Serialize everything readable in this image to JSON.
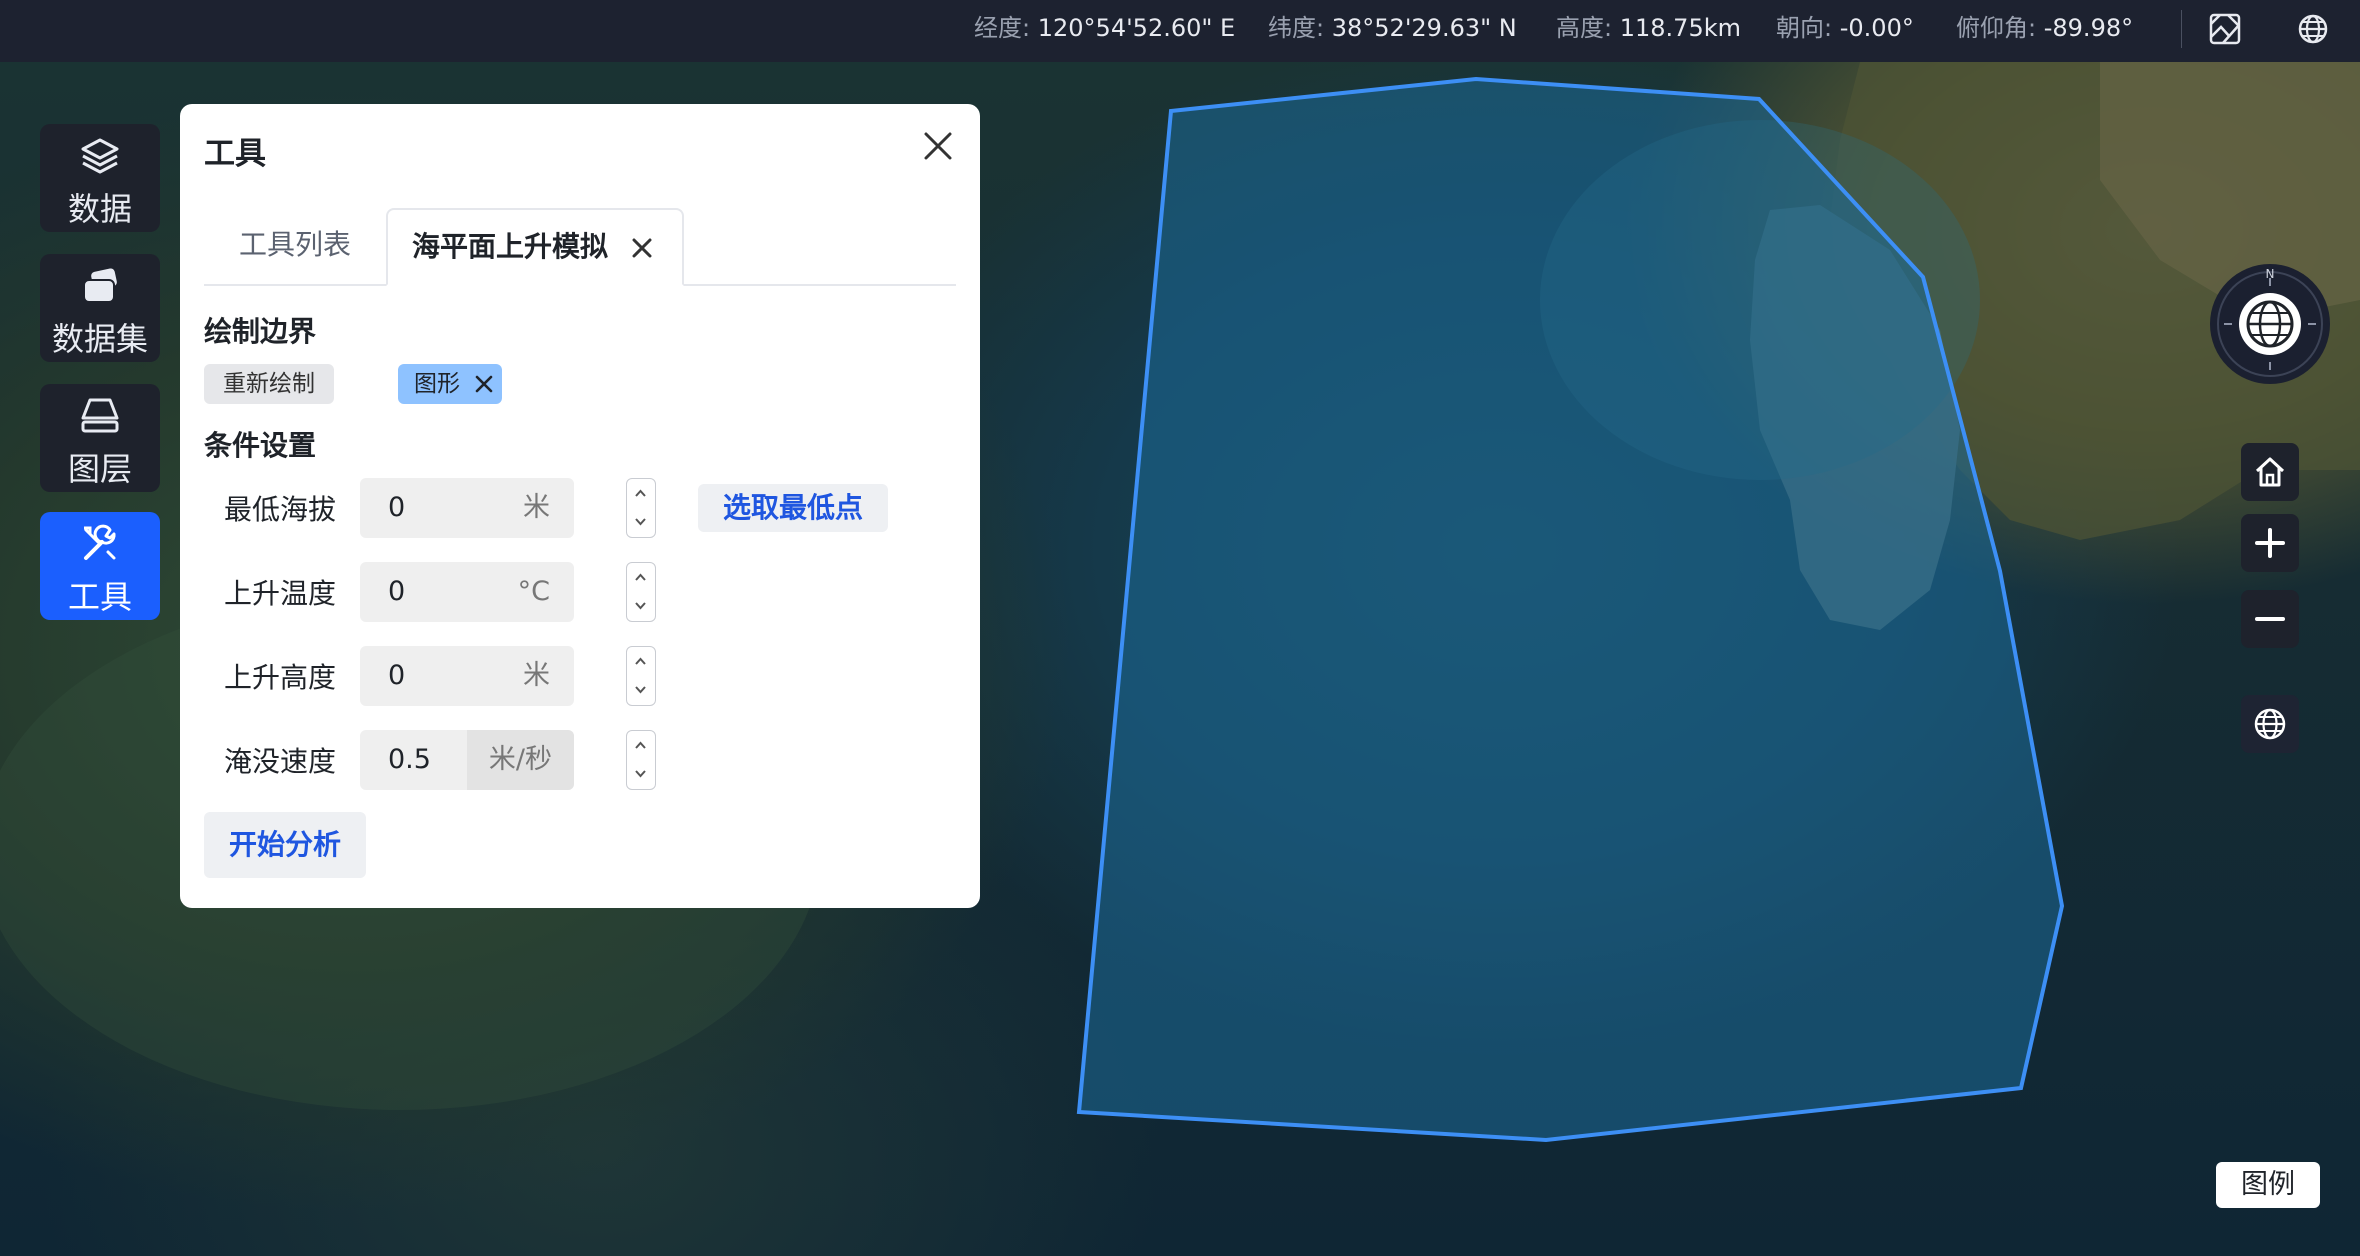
{
  "status_bar": {
    "longitude_label": "经度:",
    "longitude_value": "120°54'52.60\" E",
    "latitude_label": "纬度:",
    "latitude_value": "38°52'29.63\" N",
    "altitude_label": "高度:",
    "altitude_value": "118.75km",
    "heading_label": "朝向:",
    "heading_value": "-0.00°",
    "pitch_label": "俯仰角:",
    "pitch_value": "-89.98°",
    "icons": [
      "map-layers-icon",
      "globe-icon"
    ]
  },
  "dock": {
    "items": [
      {
        "label": "数据",
        "icon": "layers-stack-icon",
        "active": false
      },
      {
        "label": "数据集",
        "icon": "dataset-cards-icon",
        "active": false
      },
      {
        "label": "图层",
        "icon": "layer-trapezoid-icon",
        "active": false
      },
      {
        "label": "工具",
        "icon": "tools-icon",
        "active": true
      }
    ]
  },
  "panel": {
    "title": "工具",
    "tabs": [
      {
        "label": "工具列表",
        "active": false
      },
      {
        "label": "海平面上升模拟",
        "active": true,
        "closable": true
      }
    ],
    "boundary": {
      "heading": "绘制边界",
      "redraw_label": "重新绘制",
      "shape_chip": "图形"
    },
    "conditions": {
      "heading": "条件设置",
      "fields": [
        {
          "label": "最低海拔",
          "value": "0",
          "unit": "米"
        },
        {
          "label": "上升温度",
          "value": "0",
          "unit": "°C"
        },
        {
          "label": "上升高度",
          "value": "0",
          "unit": "米"
        },
        {
          "label": "淹没速度",
          "value": "0.5",
          "unit": "米/秒"
        }
      ],
      "pick_lowest_label": "选取最低点"
    },
    "start_label": "开始分析"
  },
  "compass": {
    "north_label": "N"
  },
  "legend_label": "图例",
  "colors": {
    "accent": "#1b5ffe",
    "polygon_stroke": "#3d8ff5",
    "chip_blue": "#8ec2ff",
    "link_blue": "#1f56e0"
  }
}
